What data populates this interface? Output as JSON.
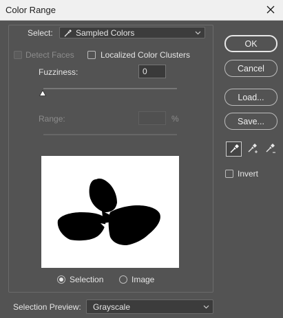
{
  "window": {
    "title": "Color Range",
    "close_icon": "close-icon"
  },
  "select": {
    "label": "Select:",
    "value": "Sampled Colors",
    "icon": "eyedropper-icon"
  },
  "options": {
    "detect_faces": {
      "label": "Detect Faces",
      "checked": false,
      "enabled": false
    },
    "localized_color_clusters": {
      "label": "Localized Color Clusters",
      "checked": false
    }
  },
  "fuzziness": {
    "label": "Fuzziness:",
    "value": "0",
    "slider_fraction": 0.0
  },
  "range": {
    "label": "Range:",
    "value": "",
    "unit": "%",
    "enabled": false
  },
  "preview_mode": {
    "selected": "Selection",
    "options": [
      "Selection",
      "Image"
    ]
  },
  "selection_preview": {
    "label": "Selection Preview:",
    "value": "Grayscale"
  },
  "buttons": {
    "ok": "OK",
    "cancel": "Cancel",
    "load": "Load...",
    "save": "Save..."
  },
  "eyedroppers": [
    {
      "icon": "eyedropper-icon",
      "active": true
    },
    {
      "icon": "eyedropper-plus-icon",
      "active": false
    },
    {
      "icon": "eyedropper-minus-icon",
      "active": false
    }
  ],
  "invert": {
    "label": "Invert",
    "checked": false
  },
  "colors": {
    "background": "#535353",
    "titlebar": "#f0f0f0",
    "preview_bg": "#ffffff",
    "mask": "#000000"
  }
}
